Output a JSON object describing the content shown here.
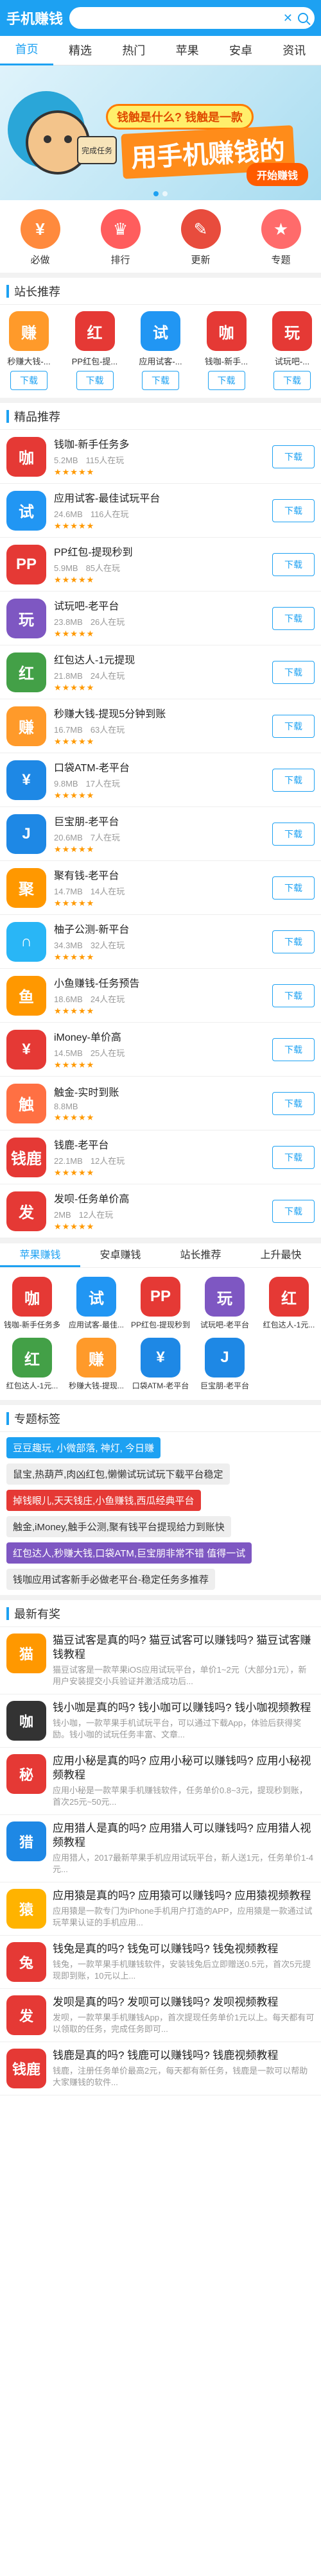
{
  "header": {
    "logo": "手机赚钱",
    "search_value": "",
    "search_placeholder": ""
  },
  "nav_tabs": [
    "首页",
    "精选",
    "热门",
    "苹果",
    "安卓",
    "资讯"
  ],
  "banner": {
    "bubble": "钱触是什么? 钱触是一款",
    "main": "用手机赚钱的",
    "cta": "开始赚钱",
    "phone": "完成任务"
  },
  "quick_nav": [
    {
      "label": "必做",
      "icon": "bag-icon",
      "color": "#ff8a3d",
      "glyph": "¥"
    },
    {
      "label": "排行",
      "icon": "trophy-icon",
      "color": "#ff5d5d",
      "glyph": "♛"
    },
    {
      "label": "更新",
      "icon": "update-icon",
      "color": "#e84c3d",
      "glyph": "✎"
    },
    {
      "label": "专题",
      "icon": "topic-icon",
      "color": "#ff6b6b",
      "glyph": "★"
    }
  ],
  "sections": {
    "recommend": "站长推荐",
    "featured": "精品推荐",
    "tags": "专题标签",
    "news": "最新有奖"
  },
  "download_label": "下载",
  "recommend": [
    {
      "name": "秒赚大钱-...",
      "color": "#ff9a2a",
      "glyph": "赚"
    },
    {
      "name": "PP红包-提...",
      "color": "#e53935",
      "glyph": "红"
    },
    {
      "name": "应用试客-...",
      "color": "#2196f3",
      "glyph": "试"
    },
    {
      "name": "钱咖-新手...",
      "color": "#e53935",
      "glyph": "咖"
    },
    {
      "name": "试玩吧-...",
      "color": "#e53935",
      "glyph": "玩"
    }
  ],
  "apps": [
    {
      "title": "钱咖-新手任务多",
      "size": "5.2MB",
      "users": "115人在玩",
      "color": "#e53935",
      "glyph": "咖"
    },
    {
      "title": "应用试客-最佳试玩平台",
      "size": "24.6MB",
      "users": "116人在玩",
      "color": "#2196f3",
      "glyph": "试"
    },
    {
      "title": "PP红包-提现秒到",
      "size": "5.9MB",
      "users": "85人在玩",
      "color": "#e53935",
      "glyph": "PP"
    },
    {
      "title": "试玩吧-老平台",
      "size": "23.8MB",
      "users": "26人在玩",
      "color": "#7e57c2",
      "glyph": "玩"
    },
    {
      "title": "红包达人-1元提现",
      "size": "21.8MB",
      "users": "24人在玩",
      "color": "#43a047",
      "glyph": "红"
    },
    {
      "title": "秒赚大钱-提现5分钟到账",
      "size": "16.7MB",
      "users": "63人在玩",
      "color": "#ff9a2a",
      "glyph": "赚"
    },
    {
      "title": "口袋ATM-老平台",
      "size": "9.8MB",
      "users": "17人在玩",
      "color": "#1e88e5",
      "glyph": "¥"
    },
    {
      "title": "巨宝朋-老平台",
      "size": "20.6MB",
      "users": "7人在玩",
      "color": "#1e88e5",
      "glyph": "J"
    },
    {
      "title": "聚有钱-老平台",
      "size": "14.7MB",
      "users": "14人在玩",
      "color": "#ff9800",
      "glyph": "聚"
    },
    {
      "title": "柚子公测-新平台",
      "size": "34.3MB",
      "users": "32人在玩",
      "color": "#29b6f6",
      "glyph": "∩"
    },
    {
      "title": "小鱼赚钱-任务预告",
      "size": "18.6MB",
      "users": "24人在玩",
      "color": "#ff9800",
      "glyph": "鱼"
    },
    {
      "title": "iMoney-单价高",
      "size": "14.5MB",
      "users": "25人在玩",
      "color": "#e53935",
      "glyph": "¥"
    },
    {
      "title": "触金-实时到账",
      "size": "8.8MB",
      "users": "",
      "color": "#ff7043",
      "glyph": "触"
    },
    {
      "title": "钱鹿-老平台",
      "size": "22.1MB",
      "users": "12人在玩",
      "color": "#e53935",
      "glyph": "钱鹿"
    },
    {
      "title": "发呗-任务单价高",
      "size": "2MB",
      "users": "12人在玩",
      "color": "#e53935",
      "glyph": "发"
    }
  ],
  "cat_tabs": [
    "苹果赚钱",
    "安卓赚钱",
    "站长推荐",
    "上升最快"
  ],
  "grid": [
    {
      "name": "钱咖-新手任务多",
      "color": "#e53935",
      "glyph": "咖"
    },
    {
      "name": "应用试客-最佳...",
      "color": "#2196f3",
      "glyph": "试"
    },
    {
      "name": "PP红包-提现秒到",
      "color": "#e53935",
      "glyph": "PP"
    },
    {
      "name": "试玩吧-老平台",
      "color": "#7e57c2",
      "glyph": "玩"
    },
    {
      "name": "红包达人-1元...",
      "color": "#e53935",
      "glyph": "红"
    },
    {
      "name": "红包达人-1元...",
      "color": "#43a047",
      "glyph": "红"
    },
    {
      "name": "秒赚大钱-提现...",
      "color": "#ff9a2a",
      "glyph": "赚"
    },
    {
      "name": "口袋ATM-老平台",
      "color": "#1e88e5",
      "glyph": "¥"
    },
    {
      "name": "巨宝朋-老平台",
      "color": "#1e88e5",
      "glyph": "J"
    }
  ],
  "tags": [
    {
      "label": "豆豆趣玩, 小微部落, 神灯, 今日赚",
      "color": "#1da1f2"
    },
    {
      "label": "鼠宝,热葫芦,肉凶红包,懒懒试玩试玩下载平台稳定",
      "color": "#eeeeee",
      "text": "#333"
    },
    {
      "label": "掉钱眼儿,天天钱庄,小鱼赚钱,西瓜经典平台",
      "color": "#e53935"
    },
    {
      "label": "触金,iMoney,触手公测,聚有钱平台提现给力到账快",
      "color": "#eeeeee",
      "text": "#333"
    },
    {
      "label": "红包达人,秒赚大钱,口袋ATM,巨宝朋非常不错 值得一试",
      "color": "#7e57c2"
    },
    {
      "label": "钱咖应用试客新手必做老平台-稳定任务多推荐",
      "color": "#eeeeee",
      "text": "#333"
    }
  ],
  "news": [
    {
      "title": "猫豆试客是真的吗? 猫豆试客可以赚钱吗? 猫豆试客赚钱教程",
      "desc": "猫豆试客是一款苹果iOS应用试玩平台，单价1~2元（大部分1元），新用户安装提交小兵验证并激活成功后...",
      "color": "#ff9800",
      "glyph": "猫"
    },
    {
      "title": "钱小咖是真的吗? 钱小咖可以赚钱吗? 钱小咖视频教程",
      "desc": "钱小咖，一款苹果手机试玩平台，可以通过下载App，体验后获得奖励。钱小咖的试玩任务丰富、文章...",
      "color": "#333",
      "glyph": "咖"
    },
    {
      "title": "应用小秘是真的吗? 应用小秘可以赚钱吗? 应用小秘视频教程",
      "desc": "应用小秘是一款苹果手机赚钱软件，任务单价0.8~3元，提现秒到账，首次25元~50元...",
      "color": "#e53935",
      "glyph": "秘"
    },
    {
      "title": "应用猎人是真的吗? 应用猎人可以赚钱吗? 应用猎人视频教程",
      "desc": "应用猎人，2017最新苹果手机应用试玩平台，新人送1元，任务单价1-4元...",
      "color": "#1e88e5",
      "glyph": "猎"
    },
    {
      "title": "应用猿是真的吗? 应用猿可以赚钱吗? 应用猿视频教程",
      "desc": "应用猿是一款专门为iPhone手机用户打造的APP，应用猿是一款通过试玩苹果认证的手机应用...",
      "color": "#ffb300",
      "glyph": "猿"
    },
    {
      "title": "钱兔是真的吗? 钱兔可以赚钱吗? 钱兔视频教程",
      "desc": "钱兔，一款苹果手机赚钱软件，安装钱兔后立即赠送0.5元，首次5元提现即到账，10元以上...",
      "color": "#e53935",
      "glyph": "兔"
    },
    {
      "title": "发呗是真的吗? 发呗可以赚钱吗? 发呗视频教程",
      "desc": "发呗，一款苹果手机赚钱App，首次提现任务单价1元以上。每天都有可以领取的任务，完成任务即可...",
      "color": "#e53935",
      "glyph": "发"
    },
    {
      "title": "钱鹿是真的吗? 钱鹿可以赚钱吗? 钱鹿视频教程",
      "desc": "钱鹿，注册任务单价最高2元，每天都有新任务，钱鹿是一款可以帮助大家赚钱的软件...",
      "color": "#e53935",
      "glyph": "钱鹿"
    }
  ]
}
